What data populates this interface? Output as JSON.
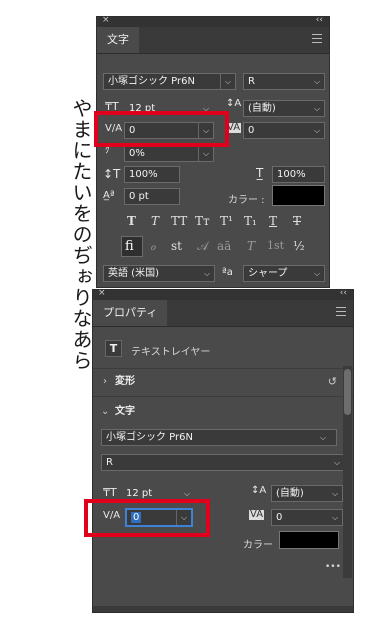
{
  "vertical_text": "やまにたいをのぢぉりなあら",
  "char_panel": {
    "close": "×",
    "collapse": "‹‹",
    "tab": "文字",
    "font_family": "小塚ゴシック Pr6N",
    "font_style": "R",
    "font_size": "12 pt",
    "leading": "(自動)",
    "kerning": "0",
    "tracking": "0",
    "tsume": "0%",
    "vscale": "100%",
    "hscale": "100%",
    "baseline": "0 pt",
    "color_label": "カラー :",
    "style_glyphs": [
      "T",
      "T",
      "TT",
      "Tт",
      "T¹",
      "T₁",
      "T",
      "T"
    ],
    "opentype_glyphs": [
      "fi",
      "ℴ",
      "st",
      "𝒜",
      "aā",
      "T",
      "1st",
      "½"
    ],
    "language": "英語 (米国)",
    "aa_icon": "ªa",
    "antialias": "シャープ"
  },
  "props_panel": {
    "close": "×",
    "collapse": "‹‹",
    "tab": "プロパティ",
    "layer_icon": "T",
    "layer_type": "テキストレイヤー",
    "transform_label": "変形",
    "text_label": "文字",
    "font_family": "小塚ゴシック Pr6N",
    "font_style": "R",
    "font_size": "12 pt",
    "leading": "(自動)",
    "kerning": "0",
    "tracking": "0",
    "color_label": "カラー",
    "more": "•••"
  },
  "colors": {
    "panel_bg": "#4a4a4a",
    "highlight": "#e0001b",
    "swatch": "#000000"
  }
}
